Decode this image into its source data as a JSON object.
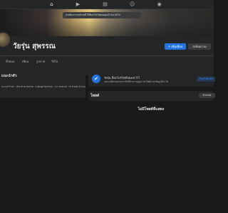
{
  "topnav": {
    "icons": [
      {
        "name": "home-icon",
        "glyph": "⌂"
      },
      {
        "name": "video-icon",
        "glyph": "▶"
      },
      {
        "name": "marketplace-icon",
        "glyph": "▤"
      },
      {
        "name": "groups-icon",
        "glyph": "☺"
      },
      {
        "name": "gaming-icon",
        "glyph": "◉"
      }
    ]
  },
  "cover": {
    "tooltip": "หากต้องการแชร์ภาพนี้ ให้ล็อกโปรไฟล์ของคุณไว้ ขอ เข้าใจ"
  },
  "profile": {
    "name": "วัยรุ่น สุพรรณ",
    "add_friend_label": "+ เพิ่มเพื่อน",
    "message_label": "ส่งข้อความ"
  },
  "tabs": [
    "ทั้งหมด",
    "เพื่อน",
    "รูปภาพ",
    "วิดีโอ"
  ],
  "intro": {
    "title": "แนะนำตัว",
    "text": "ทำงานที่ ร้านค้า · ศึกษาที่ มหาวิทยาลัย · อาศัยอยู่ที่ สุพรรณบุรี · จาก สุพรรณบุรี · เข้าร่วมเมื่อ ปี 2019"
  },
  "lock_notice": {
    "title": "วัยรุ่น ล็อกโปรไฟล์ของเขาไว้",
    "description": "เฉพาะเพื่อนของเขาเท่านั้นที่สามารถดูรูปภาพ โพสต์ และข้อมูลอื่นๆ ได้",
    "button_label": "เรียนรู้เพิ่มเติม"
  },
  "posts": {
    "title": "โพสต์",
    "filter_label": "ตัวกรอง",
    "empty_text": "ไม่มีโพสต์ที่แสดง"
  },
  "colors": {
    "accent": "#2374e1",
    "background": "#18191a",
    "surface": "#242526"
  }
}
